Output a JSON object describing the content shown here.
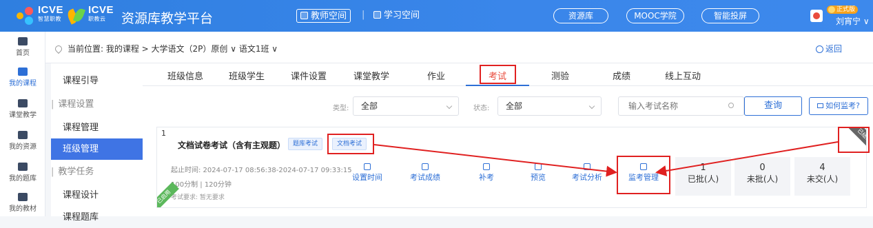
{
  "header": {
    "logo1_text": "ICVE",
    "logo1_sub": "智慧职教",
    "logo2_text": "ICVE",
    "logo2_sub": "职教云",
    "platform_title": "资源库教学平台",
    "space_tabs": [
      "教师空间",
      "学习空间"
    ],
    "separator": "|",
    "pills": [
      "资源库",
      "MOOC学院",
      "智能投屏"
    ],
    "edition_badge": "正式版",
    "username": "刘宵宁 ∨"
  },
  "leftnav": {
    "items": [
      {
        "label": "首页",
        "icon": "home-icon"
      },
      {
        "label": "我的课程",
        "icon": "book-icon"
      },
      {
        "label": "课堂教学",
        "icon": "screen-icon"
      },
      {
        "label": "我的资源",
        "icon": "resource-icon"
      },
      {
        "label": "我的题库",
        "icon": "question-bank-icon"
      },
      {
        "label": "我的教材",
        "icon": "textbook-icon"
      }
    ]
  },
  "breadcrumb": {
    "text": "当前位置: 我的课程 > 大学语文（2P）原创 ∨  语文1班 ∨",
    "back_label": "返回"
  },
  "sidebar": {
    "items": [
      {
        "label": "课程引导",
        "type": "item"
      },
      {
        "label": "课程设置",
        "type": "group"
      },
      {
        "label": "课程管理",
        "type": "item"
      },
      {
        "label": "班级管理",
        "type": "active"
      },
      {
        "label": "教学任务",
        "type": "group"
      },
      {
        "label": "课程设计",
        "type": "item"
      },
      {
        "label": "课程题库",
        "type": "item"
      }
    ]
  },
  "tabs": [
    "班级信息",
    "班级学生",
    "课件设置",
    "课堂教学",
    "作业",
    "考试",
    "测验",
    "成绩",
    "线上互动"
  ],
  "filters": {
    "type_label": "类型:",
    "type_value": "全部",
    "status_label": "状态:",
    "status_value": "全部",
    "search_placeholder": "输入考试名称",
    "query_button": "查询",
    "how_monitor_button": "如何监考?"
  },
  "exam": {
    "index": "1",
    "title": "文档试卷考试（含有主观题）",
    "tags": [
      "题库考试",
      "文档考试"
    ],
    "time": "起止时间: 2024-07-17 08:56:38-2024-07-17 09:33:15",
    "score": "100分制 | 120分钟",
    "requirement": "考试要求: 暂无要求",
    "corner_left": "已启用",
    "corner_right": "已结束",
    "actions": [
      {
        "label": "设置时间",
        "icon": "clock-upload-icon"
      },
      {
        "label": "考试成绩",
        "icon": "score-icon"
      },
      {
        "label": "补考",
        "icon": "makeup-exam-icon"
      },
      {
        "label": "预览",
        "icon": "eye-icon"
      },
      {
        "label": "考试分析",
        "icon": "analysis-icon"
      },
      {
        "label": "监考管理",
        "icon": "monitor-icon"
      }
    ],
    "stats": [
      {
        "value": "1",
        "label": "已批(人)"
      },
      {
        "value": "0",
        "label": "未批(人)"
      },
      {
        "value": "4",
        "label": "未交(人)"
      }
    ]
  },
  "colors": {
    "brand_blue": "#2f7fe0",
    "accent_blue": "#2d6fd6",
    "highlight_red": "#e02020",
    "active_sidebar": "#3f74e4"
  }
}
